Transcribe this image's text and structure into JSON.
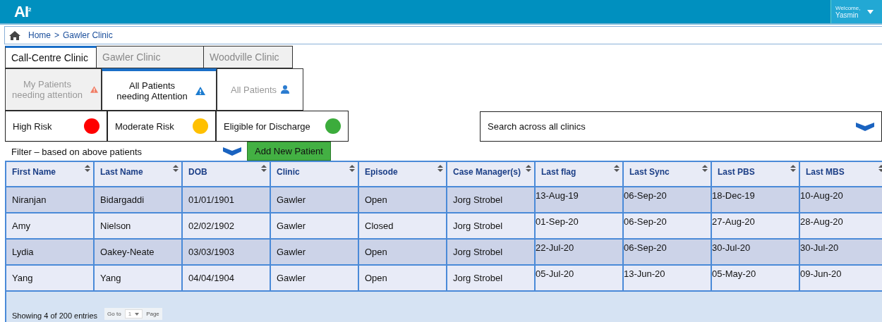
{
  "header": {
    "logo": "AI",
    "logo_sup": "2",
    "welcome": "Welcome,",
    "user": "Yasmin"
  },
  "breadcrumb": [
    "Home",
    ">",
    "Gawler Clinic"
  ],
  "clinic_tabs": [
    {
      "label": "Call-Centre Clinic",
      "selected": true
    },
    {
      "label": "Gawler Clinic",
      "selected": false
    },
    {
      "label": "Woodville Clinic",
      "selected": false
    }
  ],
  "patient_tabs": [
    {
      "label": "My Patients needing attention",
      "kind": "warning",
      "selected": false
    },
    {
      "label": "All Patients needing Attention",
      "kind": "info",
      "selected": true
    },
    {
      "label": "All Patients",
      "kind": "person",
      "selected": false
    }
  ],
  "legend": [
    {
      "label": "High Risk",
      "color": "#ff0000"
    },
    {
      "label": "Moderate Risk",
      "color": "#ffc000"
    },
    {
      "label": "Eligible for Discharge",
      "color": "#3cac3c"
    }
  ],
  "search": {
    "value": "Search across all clinics"
  },
  "filter": {
    "value": "Filter – based on above patients"
  },
  "add_button": "Add New Patient",
  "table": {
    "columns": [
      "First Name",
      "Last Name",
      "DOB",
      "Clinic",
      "Episode",
      "Case Manager(s)",
      "Last flag",
      "Last Sync",
      "Last PBS",
      "Last MBS"
    ],
    "rows": [
      [
        "Niranjan",
        "Bidargaddi",
        "01/01/1901",
        "Gawler",
        "Open",
        "Jorg Strobel",
        "13-Aug-19",
        "06-Sep-20",
        "18-Dec-19",
        "10-Aug-20"
      ],
      [
        "Amy",
        "Nielson",
        "02/02/1902",
        "Gawler",
        "Closed",
        "Jorg Strobel",
        "01-Sep-20",
        "06-Sep-20",
        "27-Aug-20",
        "28-Aug-20"
      ],
      [
        "Lydia",
        "Oakey-Neate",
        "03/03/1903",
        "Gawler",
        "Open",
        "Jorg Strobel",
        "22-Jul-20",
        "06-Sep-20",
        "30-Jul-20",
        "30-Jul-20"
      ],
      [
        "Yang",
        "Yang",
        "04/04/1904",
        "Gawler",
        "Open",
        "Jorg Strobel",
        "05-Jul-20",
        "13-Jun-20",
        "05-May-20",
        "09-Jun-20"
      ]
    ]
  },
  "footer": {
    "showing": "Showing 4 of 200 entries",
    "goto": "Go to",
    "page_value": "1",
    "page": "Page"
  }
}
